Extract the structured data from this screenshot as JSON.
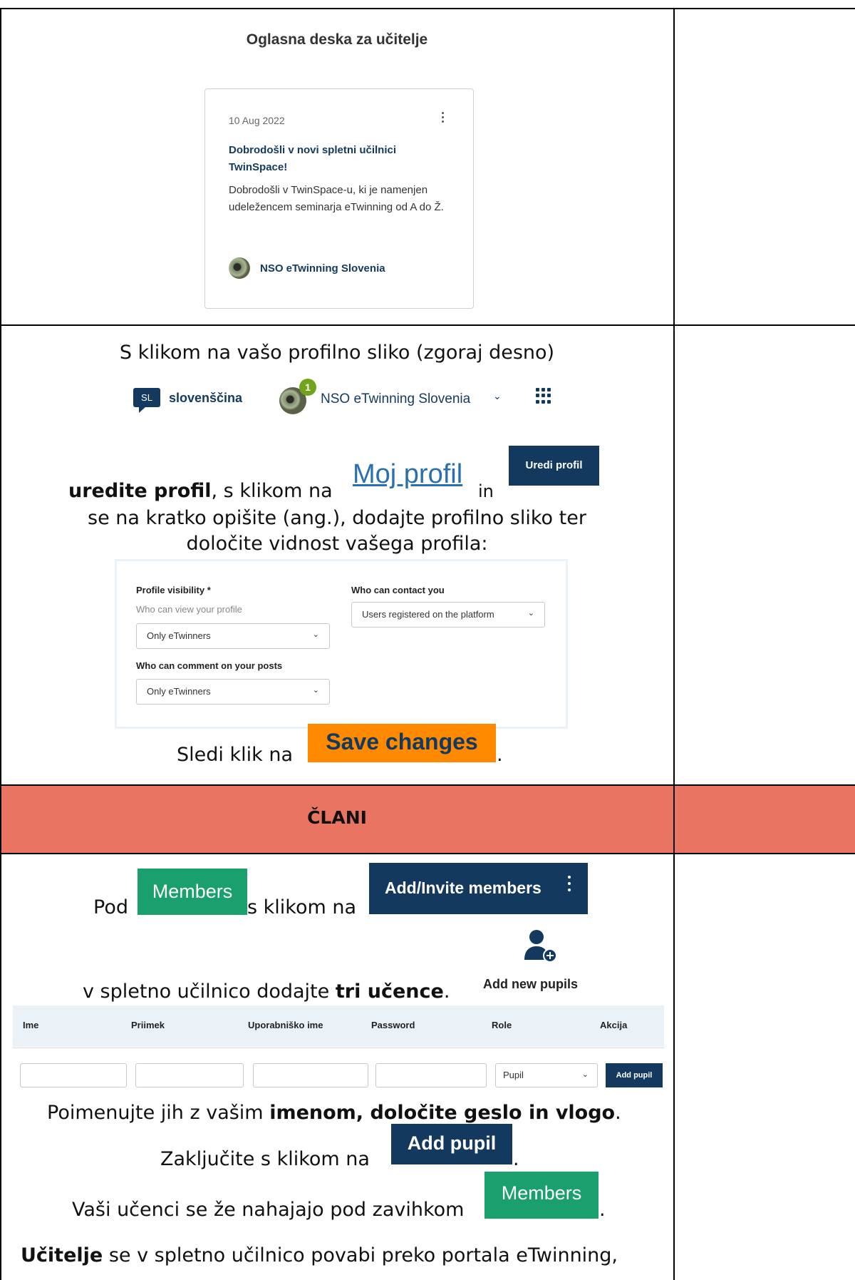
{
  "board": {
    "title": "Oglasna deska za učitelje",
    "card": {
      "date": "10 Aug 2022",
      "title": "Dobrodošli v novi spletni učilnici TwinSpace!",
      "text": "Dobrodošli v TwinSpace-u, ki je namenjen udeležencem seminarja eTwinning od A do Ž.",
      "author": "NSO eTwinning Slovenia",
      "menu_icon": "kebab-menu-icon"
    }
  },
  "profile_step": {
    "line1": "S klikom na vašo profilno sliko (zgoraj desno)",
    "nav": {
      "lang_code": "SL",
      "lang_name": "slovenščina",
      "notif_count": "1",
      "user_name": "NSO eTwinning Slovenia",
      "chevron": "⌄"
    },
    "line2_bold": "uredite profil",
    "line2_mid": ", s klikom na",
    "moj_profil": "Moj profil",
    "line2_and": "in",
    "uredi_profil": "Uredi profil",
    "line3": "se na kratko opišite (ang.), dodajte profilno sliko ter",
    "line4": "določite vidnost vašega profila:",
    "form": {
      "vis_label": "Profile visibility *",
      "vis_hint": "Who can view your profile",
      "vis_value": "Only eTwinners",
      "comment_label": "Who can comment on your posts",
      "comment_value": "Only eTwinners",
      "contact_label": "Who can contact you",
      "contact_value": "Users registered on the platform"
    },
    "next_text": "Sledi klik na",
    "save_label": "Save changes",
    "period": "."
  },
  "section_header": "ČLANI",
  "members_step": {
    "pod": "Pod",
    "members_label": "Members",
    "s_klikom": "s klikom na",
    "add_invite_label": "Add/Invite members",
    "add_text_pre": "v spletno učilnico dodajte",
    "add_text_bold": "tri učence",
    "add_text_post": ".",
    "add_new_pupils": "Add new pupils",
    "columns": [
      "Ime",
      "Priimek",
      "Uporabniško ime",
      "Password",
      "Role",
      "Akcija"
    ],
    "role_value": "Pupil",
    "row_button": "Add pupil",
    "name_pre": "Poimenujte jih z vašim",
    "name_bold": "imenom, določite geslo in vlogo",
    "name_post": ".",
    "finish_text": "Zaključite s klikom na",
    "add_pupil_label": "Add pupil",
    "already_text": "Vaši učenci se že nahajajo pod zavihkom",
    "members_label_2": "Members",
    "teachers_bold": "Učitelje",
    "teachers_text": " se v spletno učilnico povabi preko portala eTwinning,"
  },
  "colors": {
    "navy": "#14395f",
    "green": "#19a06d",
    "orange": "#ff8a00",
    "band": "#ea7462"
  }
}
